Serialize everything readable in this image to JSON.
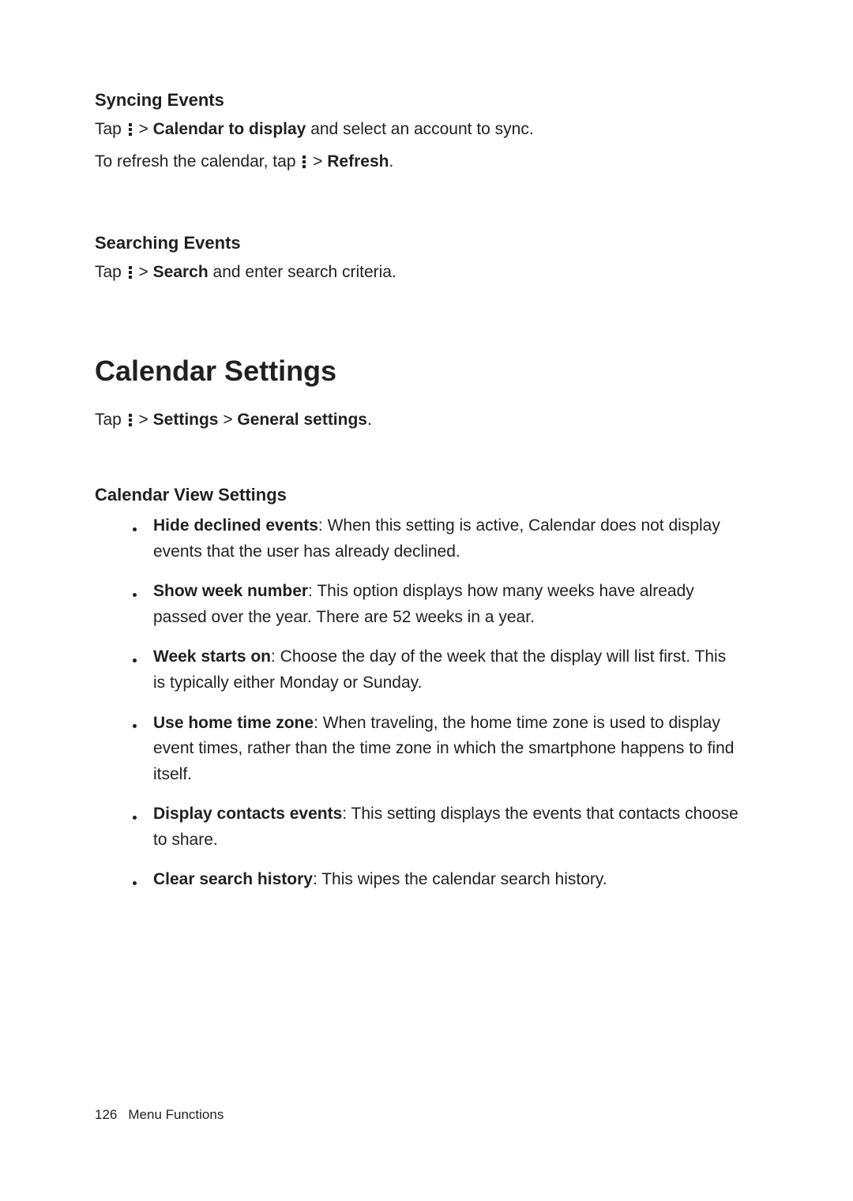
{
  "syncing": {
    "heading": "Syncing Events",
    "line1_a": "Tap ",
    "line1_b": " > ",
    "line1_bold": "Calendar to display",
    "line1_c": " and select an account to sync.",
    "line2_a": "To refresh  the calendar, tap ",
    "line2_b": " > ",
    "line2_bold": "Refresh",
    "line2_c": "."
  },
  "searching": {
    "heading": "Searching Events",
    "line1_a": "Tap ",
    "line1_b": " > ",
    "line1_bold": "Search",
    "line1_c": " and enter search criteria."
  },
  "settings": {
    "h2": "Calendar Settings",
    "line1_a": "Tap ",
    "line1_b": " > ",
    "line1_bold1": "Settings",
    "line1_c": " > ",
    "line1_bold2": "General settings",
    "line1_d": "."
  },
  "view": {
    "heading": "Calendar View Settings",
    "items": [
      {
        "bold": "Hide declined events",
        "rest": ": When this setting is active, Calendar does not display events that the user has already declined."
      },
      {
        "bold": "Show week number",
        "rest": ": This option displays how many weeks have already passed over the year. There are 52 weeks in a year."
      },
      {
        "bold": "Week starts on",
        "rest": ": Choose the day of the week that the display will list first. This is typically either Monday or Sunday."
      },
      {
        "bold": "Use home time zone",
        "rest": ": When traveling, the home time zone is used to display event times, rather than the time zone in which the smartphone happens to find itself."
      },
      {
        "bold": "Display contacts events",
        "rest": ": This setting displays the events that contacts choose to share."
      },
      {
        "bold": "Clear search history",
        "rest": ": This wipes the calendar search history."
      }
    ]
  },
  "footer": {
    "page": "126",
    "section": "Menu Functions"
  }
}
